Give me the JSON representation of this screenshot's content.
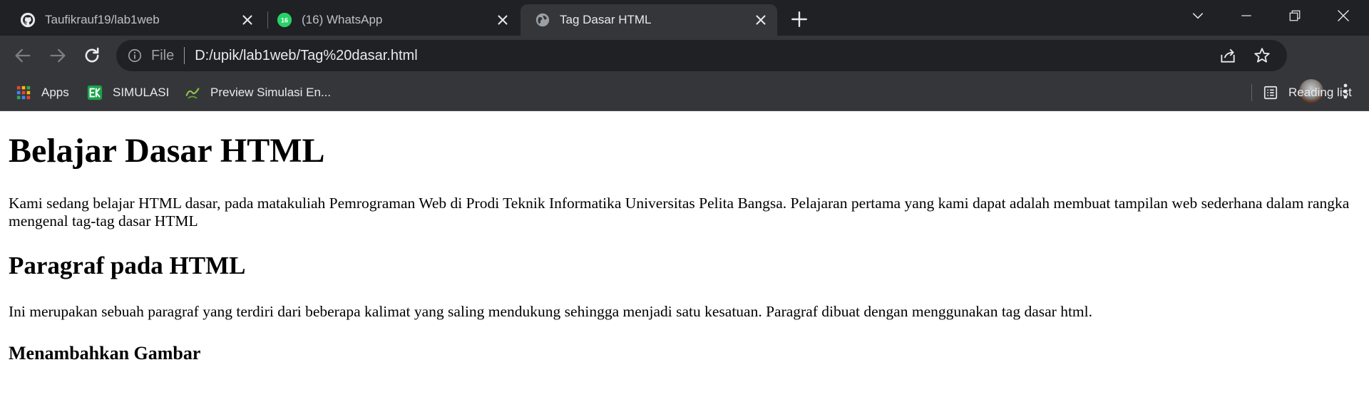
{
  "browser": {
    "tabs": [
      {
        "title": "Taufikrauf19/lab1web",
        "favicon": "github-icon",
        "active": false
      },
      {
        "title": "(16) WhatsApp",
        "favicon": "whatsapp-icon",
        "badge": "16",
        "active": false
      },
      {
        "title": "Tag Dasar HTML",
        "favicon": "globe-icon",
        "active": true
      }
    ],
    "address_bar": {
      "scheme_label": "File",
      "url": "D:/upik/lab1web/Tag%20dasar.html"
    },
    "bookmarks": [
      {
        "label": "Apps",
        "icon": "apps-grid-icon"
      },
      {
        "label": "SIMULASI",
        "icon": "ek-logo-icon"
      },
      {
        "label": "Preview Simulasi En...",
        "icon": "simulasi-logo-icon"
      }
    ],
    "reading_list_label": "Reading list",
    "colors": {
      "tabstrip": "#202124",
      "toolbar": "#35363a",
      "omnibox": "#202124",
      "text": "#e8eaed",
      "muted": "#9aa0a6",
      "whatsapp": "#25d366"
    }
  },
  "page": {
    "h1": "Belajar Dasar HTML",
    "p1": "Kami sedang belajar HTML dasar, pada matakuliah Pemrograman Web di Prodi Teknik Informatika Universitas Pelita Bangsa. Pelajaran pertama yang kami dapat adalah membuat tampilan web sederhana dalam rangka mengenal tag-tag dasar HTML",
    "h2": "Paragraf pada HTML",
    "p2": "Ini merupakan sebuah paragraf yang terdiri dari beberapa kalimat yang saling mendukung sehingga menjadi satu kesatuan. Paragraf dibuat dengan menggunakan tag dasar html.",
    "h3": "Menambahkan Gambar"
  }
}
